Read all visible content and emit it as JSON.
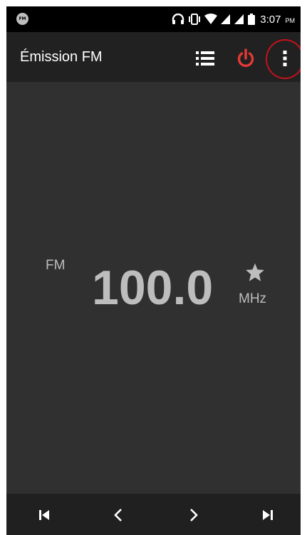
{
  "status_bar": {
    "app_icon_text": "FM",
    "time": "3:07",
    "ampm": "PM",
    "icons": [
      "headphones-icon",
      "vibrate-icon",
      "wifi-icon",
      "signal-icon",
      "signal-icon",
      "battery-icon"
    ]
  },
  "app_bar": {
    "title": "Émission FM",
    "actions": [
      "list-icon",
      "power-icon",
      "more-vert-icon"
    ],
    "power_color": "#e53935",
    "highlight_color": "#c4121a"
  },
  "tuner": {
    "band": "FM",
    "frequency": "100.0",
    "unit": "MHz",
    "favorite_icon": "star-icon"
  },
  "controls": {
    "buttons": [
      "skip-previous-icon",
      "chevron-left-icon",
      "chevron-right-icon",
      "skip-next-icon"
    ]
  }
}
